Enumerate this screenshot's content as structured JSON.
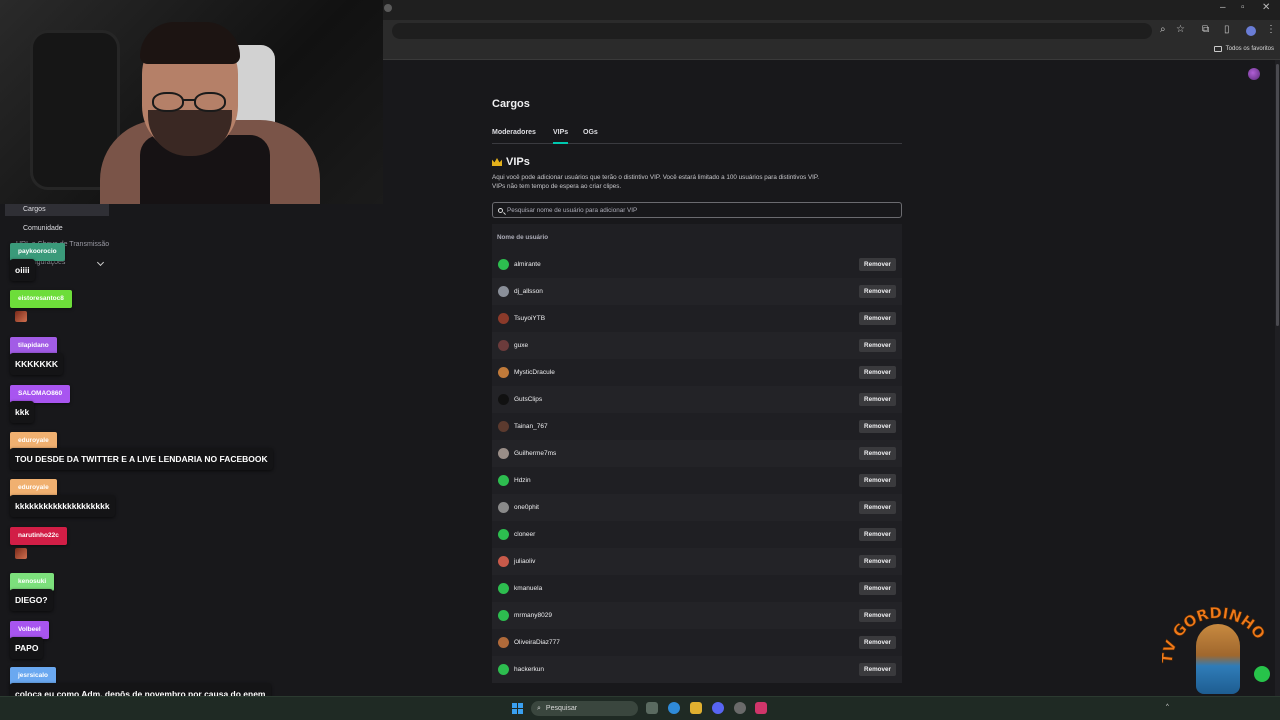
{
  "browser": {
    "bookmarks_folder": "Todos os favoritos"
  },
  "cargos": {
    "title": "Cargos",
    "tabs": [
      "Moderadores",
      "VIPs",
      "OGs"
    ],
    "active_tab": "VIPs",
    "section_title": "VIPs",
    "description_line1": "Aqui você pode adicionar usuários que terão o distintivo VIP. Você estará limitado a 100 usuários para distintivos VIP.",
    "description_line2": "VIPs não tem tempo de espera ao criar clipes.",
    "search_placeholder": "Pesquisar nome de usuário para adicionar VIP",
    "column_header": "Nome de usuário",
    "remove_label": "Remover",
    "users": [
      {
        "name": "almirante",
        "color": "#2dbd4f"
      },
      {
        "name": "dj_allsson",
        "color": "#8a8f99"
      },
      {
        "name": "TsuyoiYTB",
        "color": "#8b3a2a"
      },
      {
        "name": "guxe",
        "color": "#6b3b3b"
      },
      {
        "name": "MysticDracule",
        "color": "#c07a3a"
      },
      {
        "name": "GutsClips",
        "color": "#111111"
      },
      {
        "name": "Tainan_767",
        "color": "#5b3a2e"
      },
      {
        "name": "Guilherme7ms",
        "color": "#9a8e88"
      },
      {
        "name": "Hdzin",
        "color": "#2dbd4f"
      },
      {
        "name": "one0phit",
        "color": "#8a8a8a"
      },
      {
        "name": "cloneer",
        "color": "#2dbd4f"
      },
      {
        "name": "juliaoliv",
        "color": "#c85a4a"
      },
      {
        "name": "kmanuela",
        "color": "#2dbd4f"
      },
      {
        "name": "mrmany8029",
        "color": "#2dbd4f"
      },
      {
        "name": "OliveiraDiaz777",
        "color": "#b06a3a"
      },
      {
        "name": "hackerkun",
        "color": "#2dbd4f"
      }
    ]
  },
  "sidebar": {
    "items": [
      "Cargos",
      "Comunidade"
    ],
    "trans_item": "URL e Chave de Transmissão",
    "config_item": "Configurações"
  },
  "chat": [
    {
      "user": "paykoorocio",
      "user_color": "#3a9a7a",
      "text": "oiiii",
      "emote": false
    },
    {
      "user": "eistoresantoc8",
      "user_color": "#6ddd3a",
      "text": "",
      "emote": true
    },
    {
      "user": "tilapidano",
      "user_color": "#a25ce6",
      "text": "KKKKKKK",
      "emote": false
    },
    {
      "user": "SALOMAO860",
      "user_color": "#a855f0",
      "text": "kkk",
      "emote": false
    },
    {
      "user": "eduroyale",
      "user_color": "#f0b070",
      "text": "TOU DESDE DA TWITTER E A LIVE LENDARIA NO FACEBOOK",
      "emote": false
    },
    {
      "user": "eduroyale",
      "user_color": "#f0b070",
      "text": "kkkkkkkkkkkkkkkkkkkk",
      "emote": false
    },
    {
      "user": "narutinho22c",
      "user_color": "#d21e46",
      "text": "",
      "emote": true
    },
    {
      "user": "kenosuki",
      "user_color": "#7ce07c",
      "text": "DIEGO?",
      "emote": false
    },
    {
      "user": "Volbeel",
      "user_color": "#a855f0",
      "text": "PAPO",
      "emote": false
    },
    {
      "user": "jesrsicalo",
      "user_color": "#6aa8f0",
      "text": "coloca eu como Adm, depôs de novembro por causa do enem",
      "emote": false
    }
  ],
  "taskbar": {
    "search_label": "Pesquisar"
  },
  "logo": {
    "text": "TV GORDINHO"
  }
}
